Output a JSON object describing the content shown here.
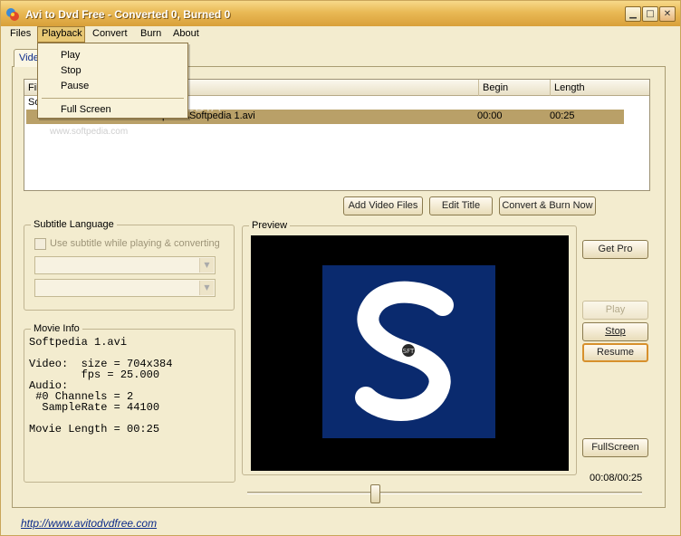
{
  "window": {
    "title": "Avi to Dvd Free - Converted 0, Burned 0",
    "minimize_glyph": "▁",
    "maximize_glyph": "□",
    "close_glyph": "✕"
  },
  "menu": {
    "items": [
      "Files",
      "Playback",
      "Convert",
      "Burn",
      "About"
    ],
    "active": "Playback"
  },
  "playback_menu": {
    "items": [
      "Play",
      "Stop",
      "Pause"
    ],
    "fullscreen": "Full Screen"
  },
  "tab": {
    "label": "Video"
  },
  "file_list": {
    "columns": [
      "File",
      "Begin",
      "Length"
    ],
    "partial_row": "So",
    "rows": [
      {
        "file": "pedia\\Softpedia 1.avi",
        "begin": "00:00",
        "length": "00:25"
      }
    ],
    "watermark": "www.softpedia.com",
    "watermark_big": "SOFTPEDIA"
  },
  "actions": {
    "add": "Add Video Files",
    "edit": "Edit Title",
    "convert": "Convert & Burn Now"
  },
  "subtitle": {
    "legend": "Subtitle Language",
    "checkbox_label": "Use subtitle while playing & converting",
    "combo_arrow": "▼"
  },
  "movie_info": {
    "legend": "Movie Info",
    "text": "Softpedia 1.avi\n\nVideo:  size = 704x384\n        fps = 25.000\nAudio:\n #0 Channels = 2\n  SampleRate = 44100\n\nMovie Length = 00:25"
  },
  "preview": {
    "legend": "Preview",
    "overlay_text": "SFT"
  },
  "side_buttons": {
    "get_pro": "Get Pro",
    "play": "Play",
    "stop": "Stop",
    "resume": "Resume",
    "fullscreen": "FullScreen"
  },
  "player": {
    "time": "00:08/00:25",
    "progress": 0.32
  },
  "footer": {
    "url": "http://www.avitodvdfree.com"
  },
  "colors": {
    "selected_row": "#b9a068",
    "preview_blue": "#0a2a6e"
  }
}
